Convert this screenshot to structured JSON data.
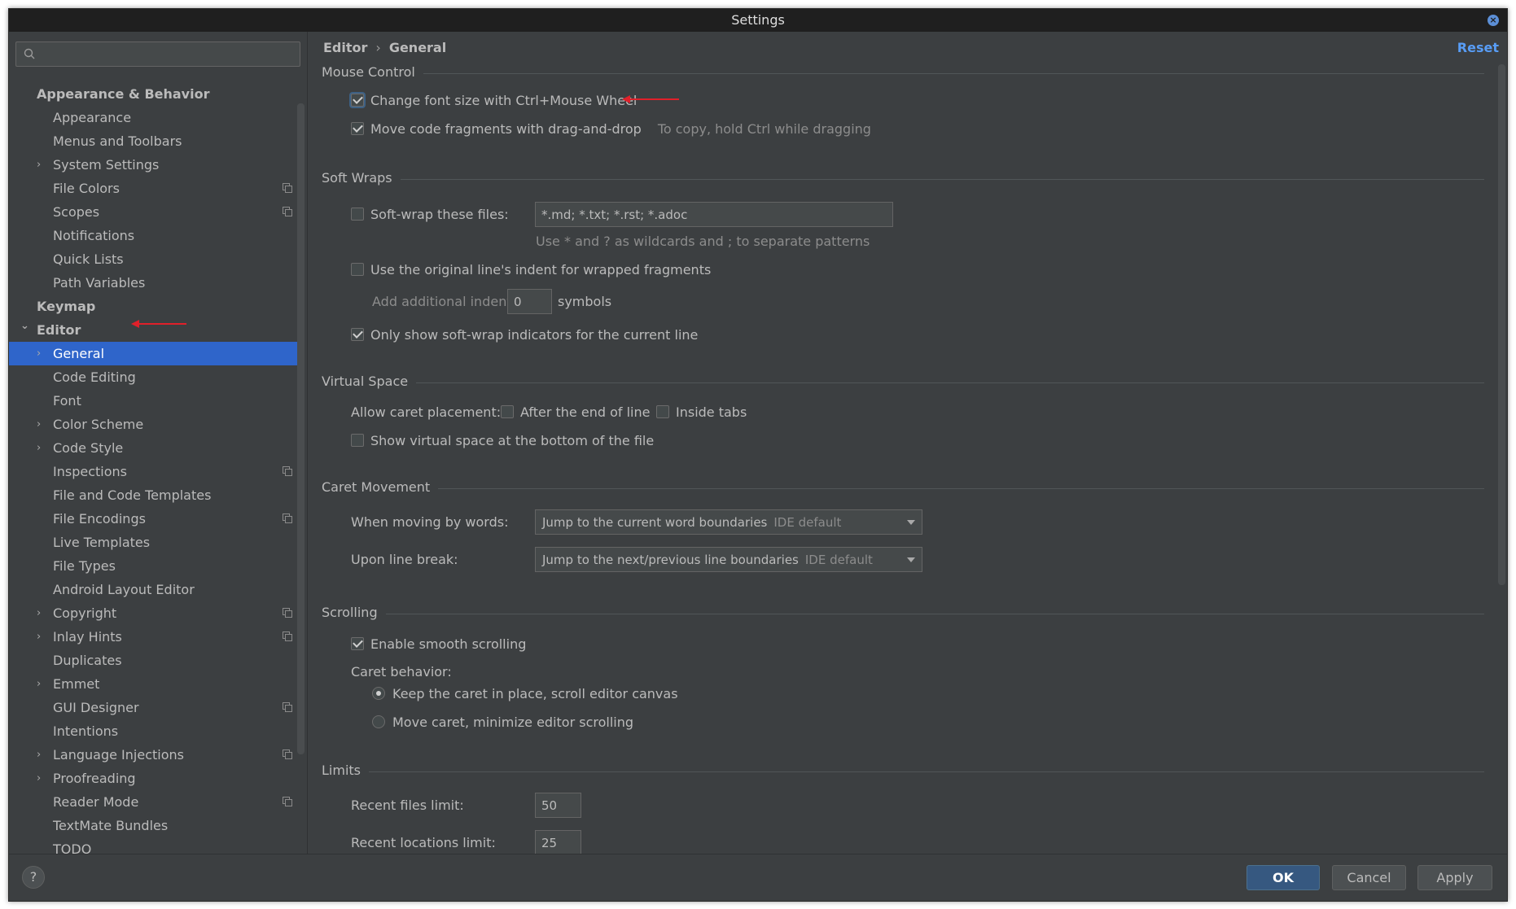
{
  "window": {
    "title": "Settings"
  },
  "search": {
    "placeholder": ""
  },
  "tree": [
    {
      "label": "Appearance & Behavior",
      "level": 0,
      "bold": true
    },
    {
      "label": "Appearance",
      "level": 1
    },
    {
      "label": "Menus and Toolbars",
      "level": 1
    },
    {
      "label": "System Settings",
      "level": 1,
      "expandable": true
    },
    {
      "label": "File Colors",
      "level": 1,
      "project": true
    },
    {
      "label": "Scopes",
      "level": 1,
      "project": true
    },
    {
      "label": "Notifications",
      "level": 1
    },
    {
      "label": "Quick Lists",
      "level": 1
    },
    {
      "label": "Path Variables",
      "level": 1
    },
    {
      "label": "Keymap",
      "level": 0,
      "bold": true
    },
    {
      "label": "Editor",
      "level": 0,
      "bold": true,
      "expanded": true
    },
    {
      "label": "General",
      "level": 1,
      "expandable": true,
      "selected": true
    },
    {
      "label": "Code Editing",
      "level": 1
    },
    {
      "label": "Font",
      "level": 1
    },
    {
      "label": "Color Scheme",
      "level": 1,
      "expandable": true
    },
    {
      "label": "Code Style",
      "level": 1,
      "expandable": true
    },
    {
      "label": "Inspections",
      "level": 1,
      "project": true
    },
    {
      "label": "File and Code Templates",
      "level": 1
    },
    {
      "label": "File Encodings",
      "level": 1,
      "project": true
    },
    {
      "label": "Live Templates",
      "level": 1
    },
    {
      "label": "File Types",
      "level": 1
    },
    {
      "label": "Android Layout Editor",
      "level": 1
    },
    {
      "label": "Copyright",
      "level": 1,
      "expandable": true,
      "project": true
    },
    {
      "label": "Inlay Hints",
      "level": 1,
      "expandable": true,
      "project": true
    },
    {
      "label": "Duplicates",
      "level": 1
    },
    {
      "label": "Emmet",
      "level": 1,
      "expandable": true
    },
    {
      "label": "GUI Designer",
      "level": 1,
      "project": true
    },
    {
      "label": "Intentions",
      "level": 1
    },
    {
      "label": "Language Injections",
      "level": 1,
      "expandable": true,
      "project": true
    },
    {
      "label": "Proofreading",
      "level": 1,
      "expandable": true
    },
    {
      "label": "Reader Mode",
      "level": 1,
      "project": true
    },
    {
      "label": "TextMate Bundles",
      "level": 1
    },
    {
      "label": "TODO",
      "level": 1
    }
  ],
  "breadcrumb": {
    "parent": "Editor",
    "separator": "›",
    "current": "General"
  },
  "reset_label": "Reset",
  "mouse_control": {
    "title": "Mouse Control",
    "font_size_wheel": "Change font size with Ctrl+Mouse Wheel",
    "drag_drop": "Move code fragments with drag-and-drop",
    "drag_drop_hint": "To copy, hold Ctrl while dragging"
  },
  "soft_wraps": {
    "title": "Soft Wraps",
    "softwrap_files": "Soft-wrap these files:",
    "softwrap_patterns": "*.md; *.txt; *.rst; *.adoc",
    "patterns_hint": "Use * and ? as wildcards and ; to separate patterns",
    "original_indent": "Use the original line's indent for wrapped fragments",
    "additional_indent": "Add additional indent:",
    "indent_value": "0",
    "symbols": "symbols",
    "current_line_only": "Only show soft-wrap indicators for the current line"
  },
  "virtual_space": {
    "title": "Virtual Space",
    "allow_caret": "Allow caret placement:",
    "after_end": "After the end of line",
    "inside_tabs": "Inside tabs",
    "bottom_of_file": "Show virtual space at the bottom of the file"
  },
  "caret_movement": {
    "title": "Caret Movement",
    "moving_by_words": "When moving by words:",
    "moving_by_words_value": "Jump to the current word boundaries",
    "line_break": "Upon line break:",
    "line_break_value": "Jump to the next/previous line boundaries",
    "ide_default": "IDE default"
  },
  "scrolling": {
    "title": "Scrolling",
    "smooth": "Enable smooth scrolling",
    "caret_behavior": "Caret behavior:",
    "keep_caret": "Keep the caret in place, scroll editor canvas",
    "move_caret": "Move caret, minimize editor scrolling"
  },
  "limits": {
    "title": "Limits",
    "recent_files": "Recent files limit:",
    "recent_files_value": "50",
    "recent_locations": "Recent locations limit:",
    "recent_locations_value": "25"
  },
  "buttons": {
    "help": "?",
    "ok": "OK",
    "cancel": "Cancel",
    "apply": "Apply"
  },
  "colors": {
    "accent": "#2f65ca",
    "annotation": "#e0202a",
    "link": "#589df6"
  }
}
